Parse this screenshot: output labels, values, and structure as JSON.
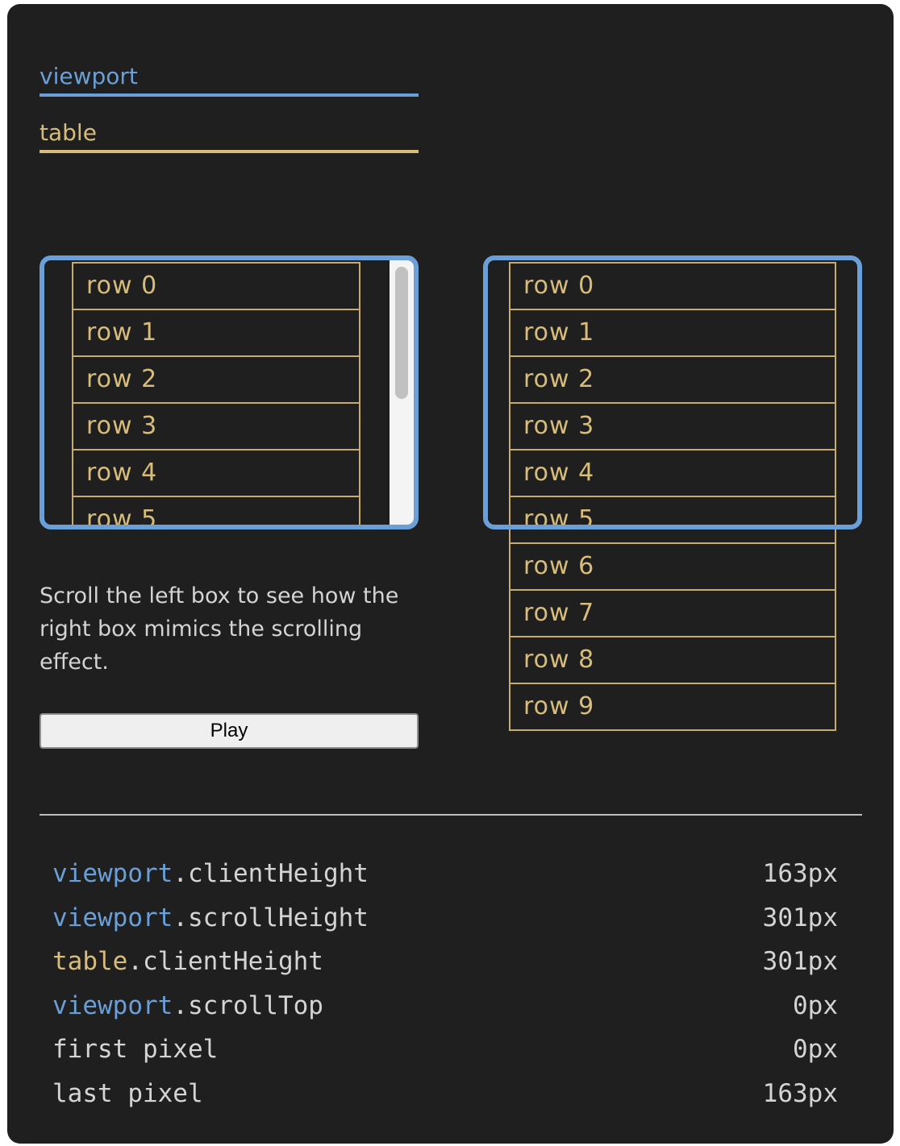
{
  "legend": {
    "viewport": "viewport",
    "table": "table"
  },
  "rows": [
    "row 0",
    "row 1",
    "row 2",
    "row 3",
    "row 4",
    "row 5",
    "row 6",
    "row 7",
    "row 8",
    "row 9"
  ],
  "description": "Scroll the left box to see how the right box mimics the scrolling effect.",
  "play_label": "Play",
  "stats": [
    {
      "kw": "viewport",
      "prop": ".clientHeight",
      "value": "163px"
    },
    {
      "kw": "viewport",
      "prop": ".scrollHeight",
      "value": "301px"
    },
    {
      "kw": "table",
      "prop": ".clientHeight",
      "value": "301px"
    },
    {
      "kw": "viewport",
      "prop": ".scrollTop",
      "value": "0px"
    },
    {
      "kw": "",
      "prop": "first pixel",
      "value": "0px"
    },
    {
      "kw": "",
      "prop": "last pixel",
      "value": "163px"
    }
  ],
  "colors": {
    "panel": "#1f1f1f",
    "viewport": "#6a9fd8",
    "table": "#d8bd7a"
  }
}
